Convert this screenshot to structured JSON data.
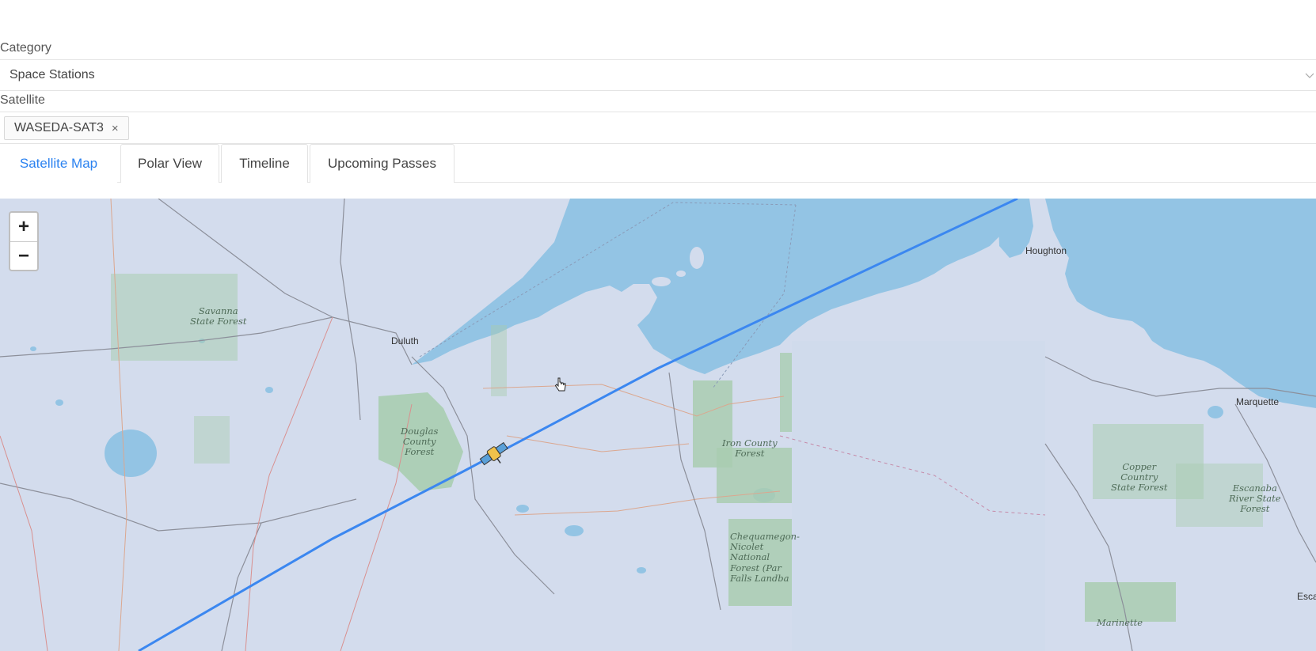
{
  "category": {
    "label": "Category",
    "selected": "Space Stations"
  },
  "satellite": {
    "label": "Satellite",
    "selected_tag": "WASEDA-SAT3",
    "remove_glyph": "×"
  },
  "tabs": [
    {
      "label": "Satellite Map",
      "active": true
    },
    {
      "label": "Polar View",
      "active": false
    },
    {
      "label": "Timeline",
      "active": false
    },
    {
      "label": "Upcoming Passes",
      "active": false
    }
  ],
  "map": {
    "zoom_in": "+",
    "zoom_out": "−",
    "places": {
      "duluth": "Duluth",
      "houghton": "Houghton",
      "marquette": "Marquette",
      "escanaba": "Esca"
    },
    "forests": {
      "savanna": "Savanna\nState Forest",
      "douglas": "Douglas\nCounty\nForest",
      "iron": "Iron County\nForest",
      "chequamegon": "Chequamegon-\nNicolet\nNational\nForest (Par\nFalls Landba",
      "copper": "Copper\nCountry\nState Forest",
      "escanaba_river": "Escanaba\nRiver State\nForest",
      "marinette": "Marinette"
    },
    "icons": {
      "satellite": "satellite-icon",
      "cursor": "hand-cursor-icon"
    },
    "colors": {
      "land": "#d3dced",
      "water": "#93c4e4",
      "forest": "#a9cdb0",
      "track": "#3b87f0"
    }
  }
}
